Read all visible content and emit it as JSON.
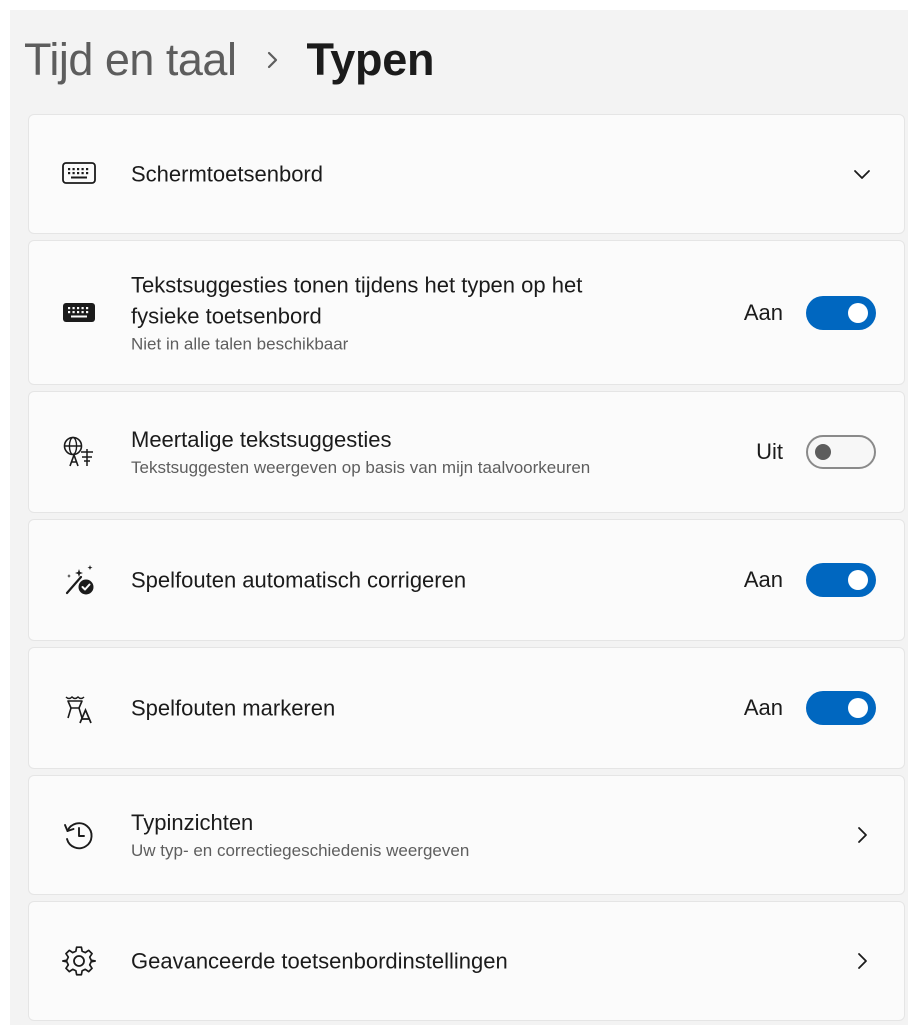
{
  "breadcrumb": {
    "parent": "Tijd en taal",
    "current": "Typen"
  },
  "settings": [
    {
      "title": "Schermtoetsenbord",
      "icon": "touch-keyboard-icon",
      "control": "expand"
    },
    {
      "title_line1": "Tekstsuggesties tonen tijdens het typen op het",
      "title_line2": "fysieke toetsenbord",
      "subtitle": "Niet in alle talen beschikbaar",
      "icon": "keyboard-icon",
      "state": "Aan",
      "on": true
    },
    {
      "title": "Meertalige tekstsuggesties",
      "subtitle": "Tekstsuggesten weergeven op basis van mijn taalvoorkeuren",
      "icon": "language-icon",
      "state": "Uit",
      "on": false
    },
    {
      "title": "Spelfouten automatisch corrigeren",
      "icon": "autocorrect-icon",
      "state": "Aan",
      "on": true
    },
    {
      "title": "Spelfouten markeren",
      "icon": "spelling-icon",
      "state": "Aan",
      "on": true
    },
    {
      "title": "Typinzichten",
      "subtitle": "Uw typ- en correctiegeschiedenis weergeven",
      "icon": "history-icon",
      "control": "navigate"
    },
    {
      "title": "Geavanceerde toetsenbordinstellingen",
      "icon": "gear-icon",
      "control": "navigate"
    }
  ],
  "colors": {
    "accent": "#0067c0",
    "background": "#f3f3f3",
    "card": "#fbfbfb"
  }
}
